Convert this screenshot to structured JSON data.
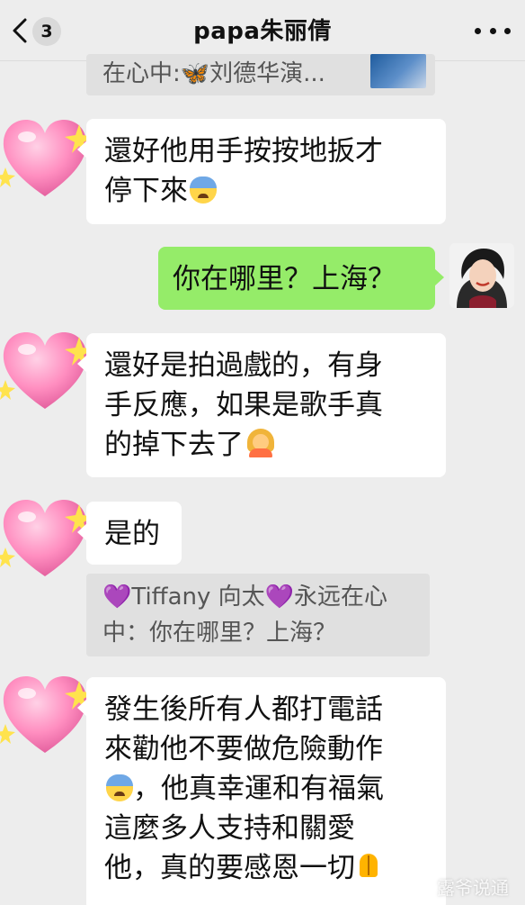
{
  "header": {
    "back_label": "<",
    "unread_count": "3",
    "title": "papa朱丽倩",
    "more_icon": "more-dots-icon"
  },
  "messages": {
    "quote_1": {
      "text": "在心中:🦋刘德华演..."
    },
    "msg_1": {
      "line1": "還好他用手按按地扳才",
      "line2": "停下來"
    },
    "msg_2": {
      "text": "你在哪里？上海？"
    },
    "msg_3": {
      "line1": "還好是拍過戲的，有身",
      "line2": "手反應，如果是歌手真",
      "line3": "的掉下去了"
    },
    "msg_4": {
      "text": "是的"
    },
    "quote_2": {
      "heart": "💜",
      "name": "Tiffany 向太",
      "heart2": "💜",
      "line1_tail": "永远在心",
      "line2": "中：你在哪里？上海？"
    },
    "msg_5": {
      "line1": "發生後所有人都打電話",
      "line2": "來勸他不要做危險動作",
      "line3": "，他真幸運和有福氣",
      "line4": "這麼多人支持和關愛",
      "line5": "他，真的要感恩一切"
    }
  },
  "watermark": "露爷说通",
  "colors": {
    "background": "#ededed",
    "bubble_incoming": "#ffffff",
    "bubble_outgoing": "#95ec69",
    "quote_bg": "#e0e0e0"
  }
}
